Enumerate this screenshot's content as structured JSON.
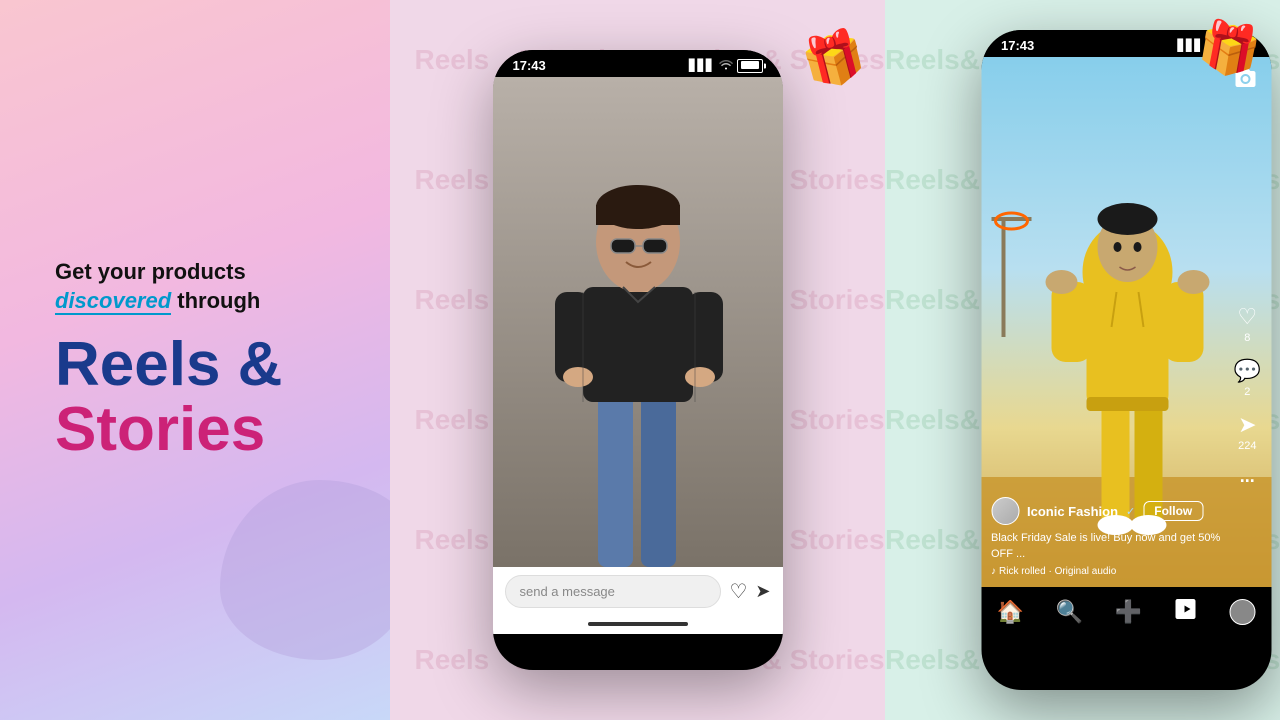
{
  "left": {
    "tagline_line1": "Get your products",
    "tagline_discovered": "discovered",
    "tagline_through": " through",
    "headline_reels": "Reels &",
    "headline_stories": "Stories"
  },
  "watermark_texts": [
    "Reels",
    "& Stories",
    "Reels",
    "& Stories",
    "Reels",
    "& Stories",
    "Reels",
    "& Stories"
  ],
  "phone1": {
    "time": "17:43",
    "message_placeholder": "send a message",
    "signal": "▋▋▋",
    "wifi": "WiFi",
    "battery": "🔋"
  },
  "phone2": {
    "time": "17:43",
    "username": "Iconic Fashion",
    "verified": "✓",
    "follow_label": "Follow",
    "caption": "Black Friday Sale is live!  Buy now and get 50% OFF ...",
    "audio": "Rick rolled · Original audio",
    "likes": "8",
    "comments": "2",
    "shares": "224",
    "more_options": "...",
    "music_note": "♪"
  },
  "colors": {
    "left_bg_start": "#f9c6d0",
    "left_bg_end": "#c8d8f8",
    "reels_color": "#1a3a8c",
    "stories_color": "#cc2277",
    "discovered_color": "#0099cc"
  }
}
